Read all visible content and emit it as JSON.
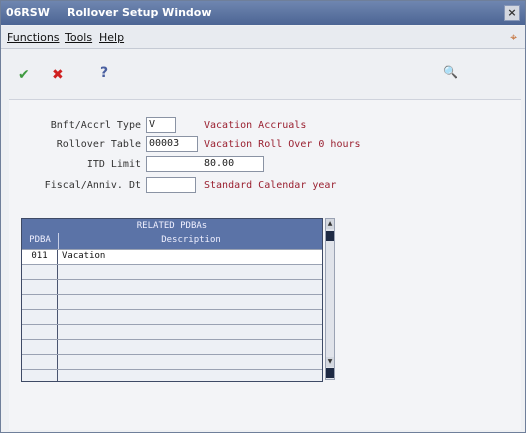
{
  "window": {
    "code": "06RSW",
    "title": "Rollover Setup Window",
    "close_glyph": "×"
  },
  "menu": {
    "functions": "Functions",
    "tools": "Tools",
    "help": "Help",
    "flag_glyph": "⌖"
  },
  "toolbar": {
    "ok_glyph": "✔",
    "cancel_glyph": "✖",
    "help_glyph": "?",
    "search_glyph": "🔍"
  },
  "form": {
    "bnft_label": "Bnft/Accrl Type",
    "bnft_value": "V",
    "bnft_desc": "Vacation Accruals",
    "rollover_label": "Rollover Table",
    "rollover_value": "00003",
    "rollover_desc": "Vacation Roll Over 0 hours",
    "itd_label": "ITD Limit",
    "itd_value": "80.00",
    "fiscal_label": "Fiscal/Anniv. Dt",
    "fiscal_value": "",
    "fiscal_desc": "Standard Calendar year"
  },
  "grid": {
    "title": "RELATED PDBAs",
    "col1": "PDBA",
    "col2": "Description",
    "rows": [
      {
        "pdba": "011",
        "description": "Vacation"
      },
      {
        "pdba": "",
        "description": ""
      },
      {
        "pdba": "",
        "description": ""
      },
      {
        "pdba": "",
        "description": ""
      },
      {
        "pdba": "",
        "description": ""
      },
      {
        "pdba": "",
        "description": ""
      },
      {
        "pdba": "",
        "description": ""
      },
      {
        "pdba": "",
        "description": ""
      },
      {
        "pdba": "",
        "description": ""
      }
    ]
  }
}
